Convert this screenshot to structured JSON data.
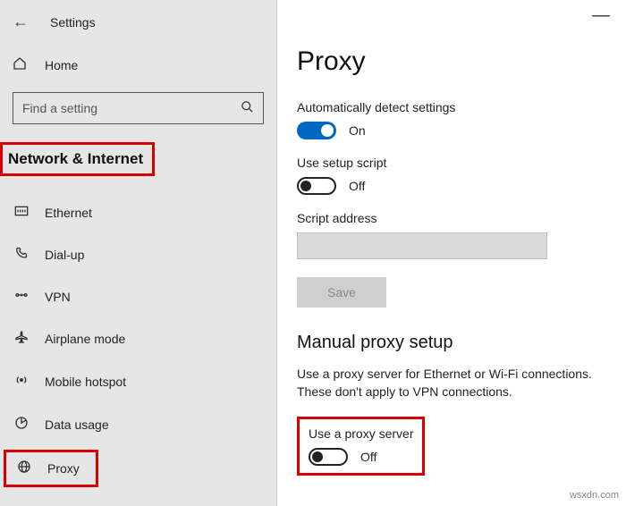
{
  "header": {
    "title": "Settings"
  },
  "sidebar": {
    "home_label": "Home",
    "search_placeholder": "Find a setting",
    "section_header": "Network & Internet",
    "items": [
      {
        "icon": "ethernet",
        "label": "Ethernet"
      },
      {
        "icon": "dialup",
        "label": "Dial-up"
      },
      {
        "icon": "vpn",
        "label": "VPN"
      },
      {
        "icon": "airplane",
        "label": "Airplane mode"
      },
      {
        "icon": "hotspot",
        "label": "Mobile hotspot"
      },
      {
        "icon": "data",
        "label": "Data usage"
      },
      {
        "icon": "proxy",
        "label": "Proxy"
      }
    ]
  },
  "main": {
    "page_title": "Proxy",
    "auto_detect_label": "Automatically detect settings",
    "auto_detect_state": "On",
    "setup_script_label": "Use setup script",
    "setup_script_state": "Off",
    "script_address_label": "Script address",
    "save_label": "Save",
    "manual_heading": "Manual proxy setup",
    "manual_desc": "Use a proxy server for Ethernet or Wi-Fi connections. These don't apply to VPN connections.",
    "use_proxy_label": "Use a proxy server",
    "use_proxy_state": "Off"
  },
  "watermark": "wsxdn.com"
}
